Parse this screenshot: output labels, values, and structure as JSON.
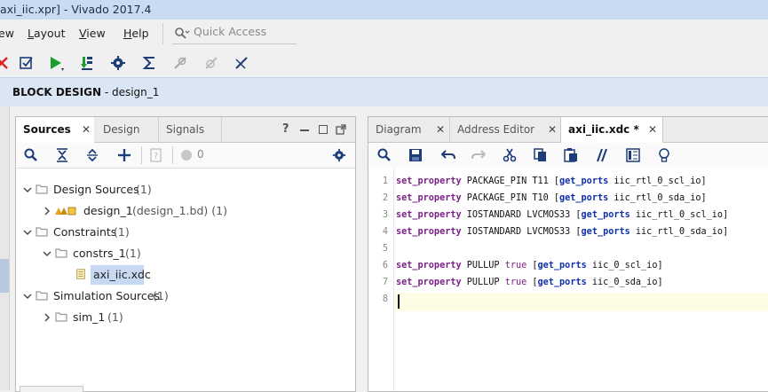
{
  "window": {
    "title": "axi_iic.xpr] - Vivado 2017.4"
  },
  "menu": [
    {
      "label": "ew",
      "underline": ""
    },
    {
      "label": "Layout",
      "underline": "L"
    },
    {
      "label": "View",
      "underline": "V"
    },
    {
      "label": "Help",
      "underline": "H"
    }
  ],
  "quick_access": {
    "placeholder": "Quick Access"
  },
  "banner": {
    "prefix": "BLOCK DESIGN",
    "suffix": " - design_1"
  },
  "sources_panel": {
    "tabs": [
      "Sources",
      "Design",
      "Signals"
    ],
    "badge_count": "0",
    "tree": [
      {
        "label": "Design Sources",
        "count": "(1)"
      },
      {
        "label": "design_1",
        "count": "(design_1.bd) (1)"
      },
      {
        "label": "Constraints",
        "count": "(1)"
      },
      {
        "label": "constrs_1",
        "count": "(1)"
      },
      {
        "label": "axi_iic.xdc",
        "count": ""
      },
      {
        "label": "Simulation Sources",
        "count": "(1)"
      },
      {
        "label": "sim_1",
        "count": "(1)"
      }
    ]
  },
  "editor_panel": {
    "tabs": [
      "Diagram",
      "Address Editor",
      "axi_iic.xdc *"
    ],
    "lines": [
      {
        "n": "1",
        "kw": "set_property",
        "a": " PACKAGE_PIN T11 [",
        "cmd": "get_ports",
        "b": " iic_rtl_0_scl_io]"
      },
      {
        "n": "2",
        "kw": "set_property",
        "a": " PACKAGE_PIN T10 [",
        "cmd": "get_ports",
        "b": " iic_rtl_0_sda_io]"
      },
      {
        "n": "3",
        "kw": "set_property",
        "a": " IOSTANDARD LVCMOS33 [",
        "cmd": "get_ports",
        "b": " iic_rtl_0_scl_io]"
      },
      {
        "n": "4",
        "kw": "set_property",
        "a": " IOSTANDARD LVCMOS33 [",
        "cmd": "get_ports",
        "b": " iic_rtl_0_sda_io]"
      },
      {
        "n": "5",
        "kw": "",
        "a": "",
        "cmd": "",
        "b": ""
      },
      {
        "n": "6",
        "kw": "set_property",
        "a": " PULLUP ",
        "bool": "true",
        "a2": " [",
        "cmd": "get_ports",
        "b": " iic_0_scl_io]"
      },
      {
        "n": "7",
        "kw": "set_property",
        "a": " PULLUP ",
        "bool": "true",
        "a2": " [",
        "cmd": "get_ports",
        "b": " iic_0_sda_io]"
      },
      {
        "n": "8",
        "kw": "",
        "a": "",
        "cmd": "",
        "b": ""
      }
    ]
  },
  "colors": {
    "banner": "#dbe6f5",
    "keyword": "#7a1f87",
    "command": "#0f2fa8",
    "active_line": "#fdfde6"
  }
}
